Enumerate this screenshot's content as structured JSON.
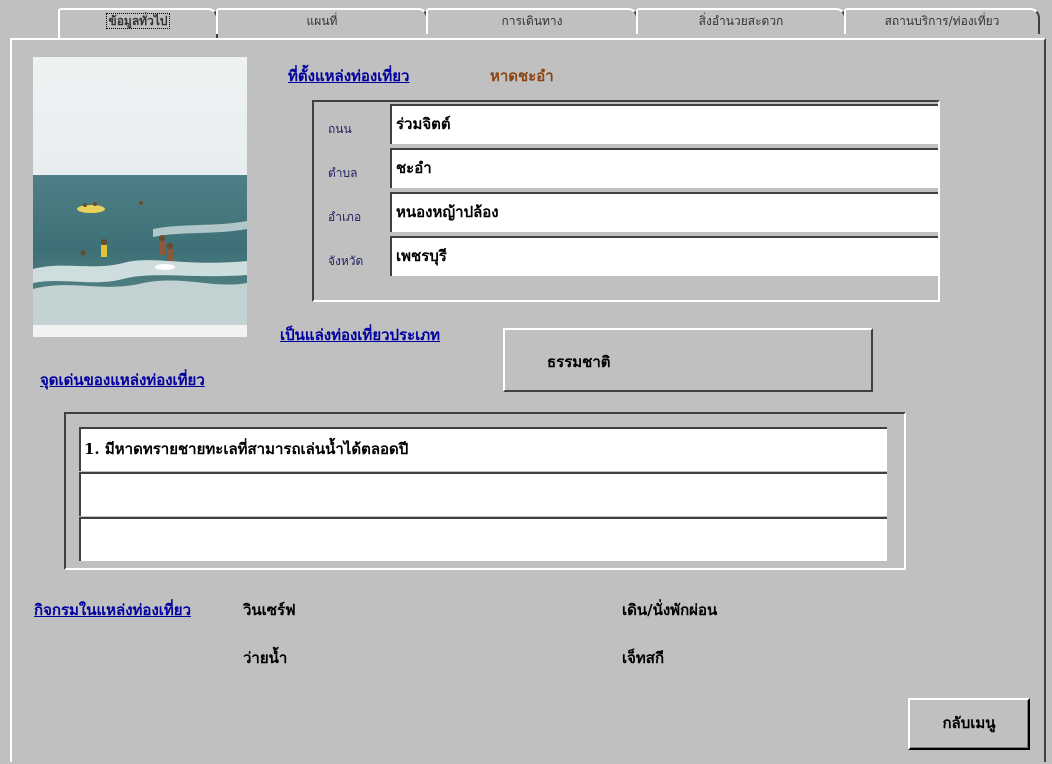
{
  "tabs": [
    {
      "label": "ข้อมูลทั่วไป",
      "active": true
    },
    {
      "label": "แผนที่",
      "active": false
    },
    {
      "label": "การเดินทาง",
      "active": false
    },
    {
      "label": "สิ่งอำนวยสะดวก",
      "active": false
    },
    {
      "label": "สถานบริการ/ท่องเที่ยว",
      "active": false
    }
  ],
  "location": {
    "heading": "ที่ตั้งแหล่งท่องเที่ยว",
    "name": "หาดชะอำ",
    "fields": [
      {
        "label": "ถนน",
        "value": "ร่วมจิตต์"
      },
      {
        "label": "ตำบล",
        "value": "ชะอำ"
      },
      {
        "label": "อำเภอ",
        "value": "หนองหญ้าปล้อง"
      },
      {
        "label": "จังหวัด",
        "value": "เพชรบุรี"
      }
    ]
  },
  "type": {
    "heading": "เป็นแล่งท่องเที่ยวประเภท",
    "value": "ธรรมชาติ"
  },
  "highlights": {
    "heading": "จุดเด่นของแหล่งท่องเที่ยว",
    "lines": [
      "1. มีหาดทรายชายทะเลที่สามารถเล่นน้ำได้ตลอดปี",
      "",
      ""
    ]
  },
  "activities": {
    "heading": "กิจกรมในแหล่งท่องเที่ยว",
    "items": [
      "วินเซร์ฟ",
      "ว่ายน้ำ",
      "เดิน/นั่งพักผ่อน",
      "เจ็ทสกี"
    ]
  },
  "back_button": "กลับเมนู",
  "colors": {
    "window": "#c0c0c0",
    "link": "#0000a0",
    "accent": "#8b4513"
  }
}
